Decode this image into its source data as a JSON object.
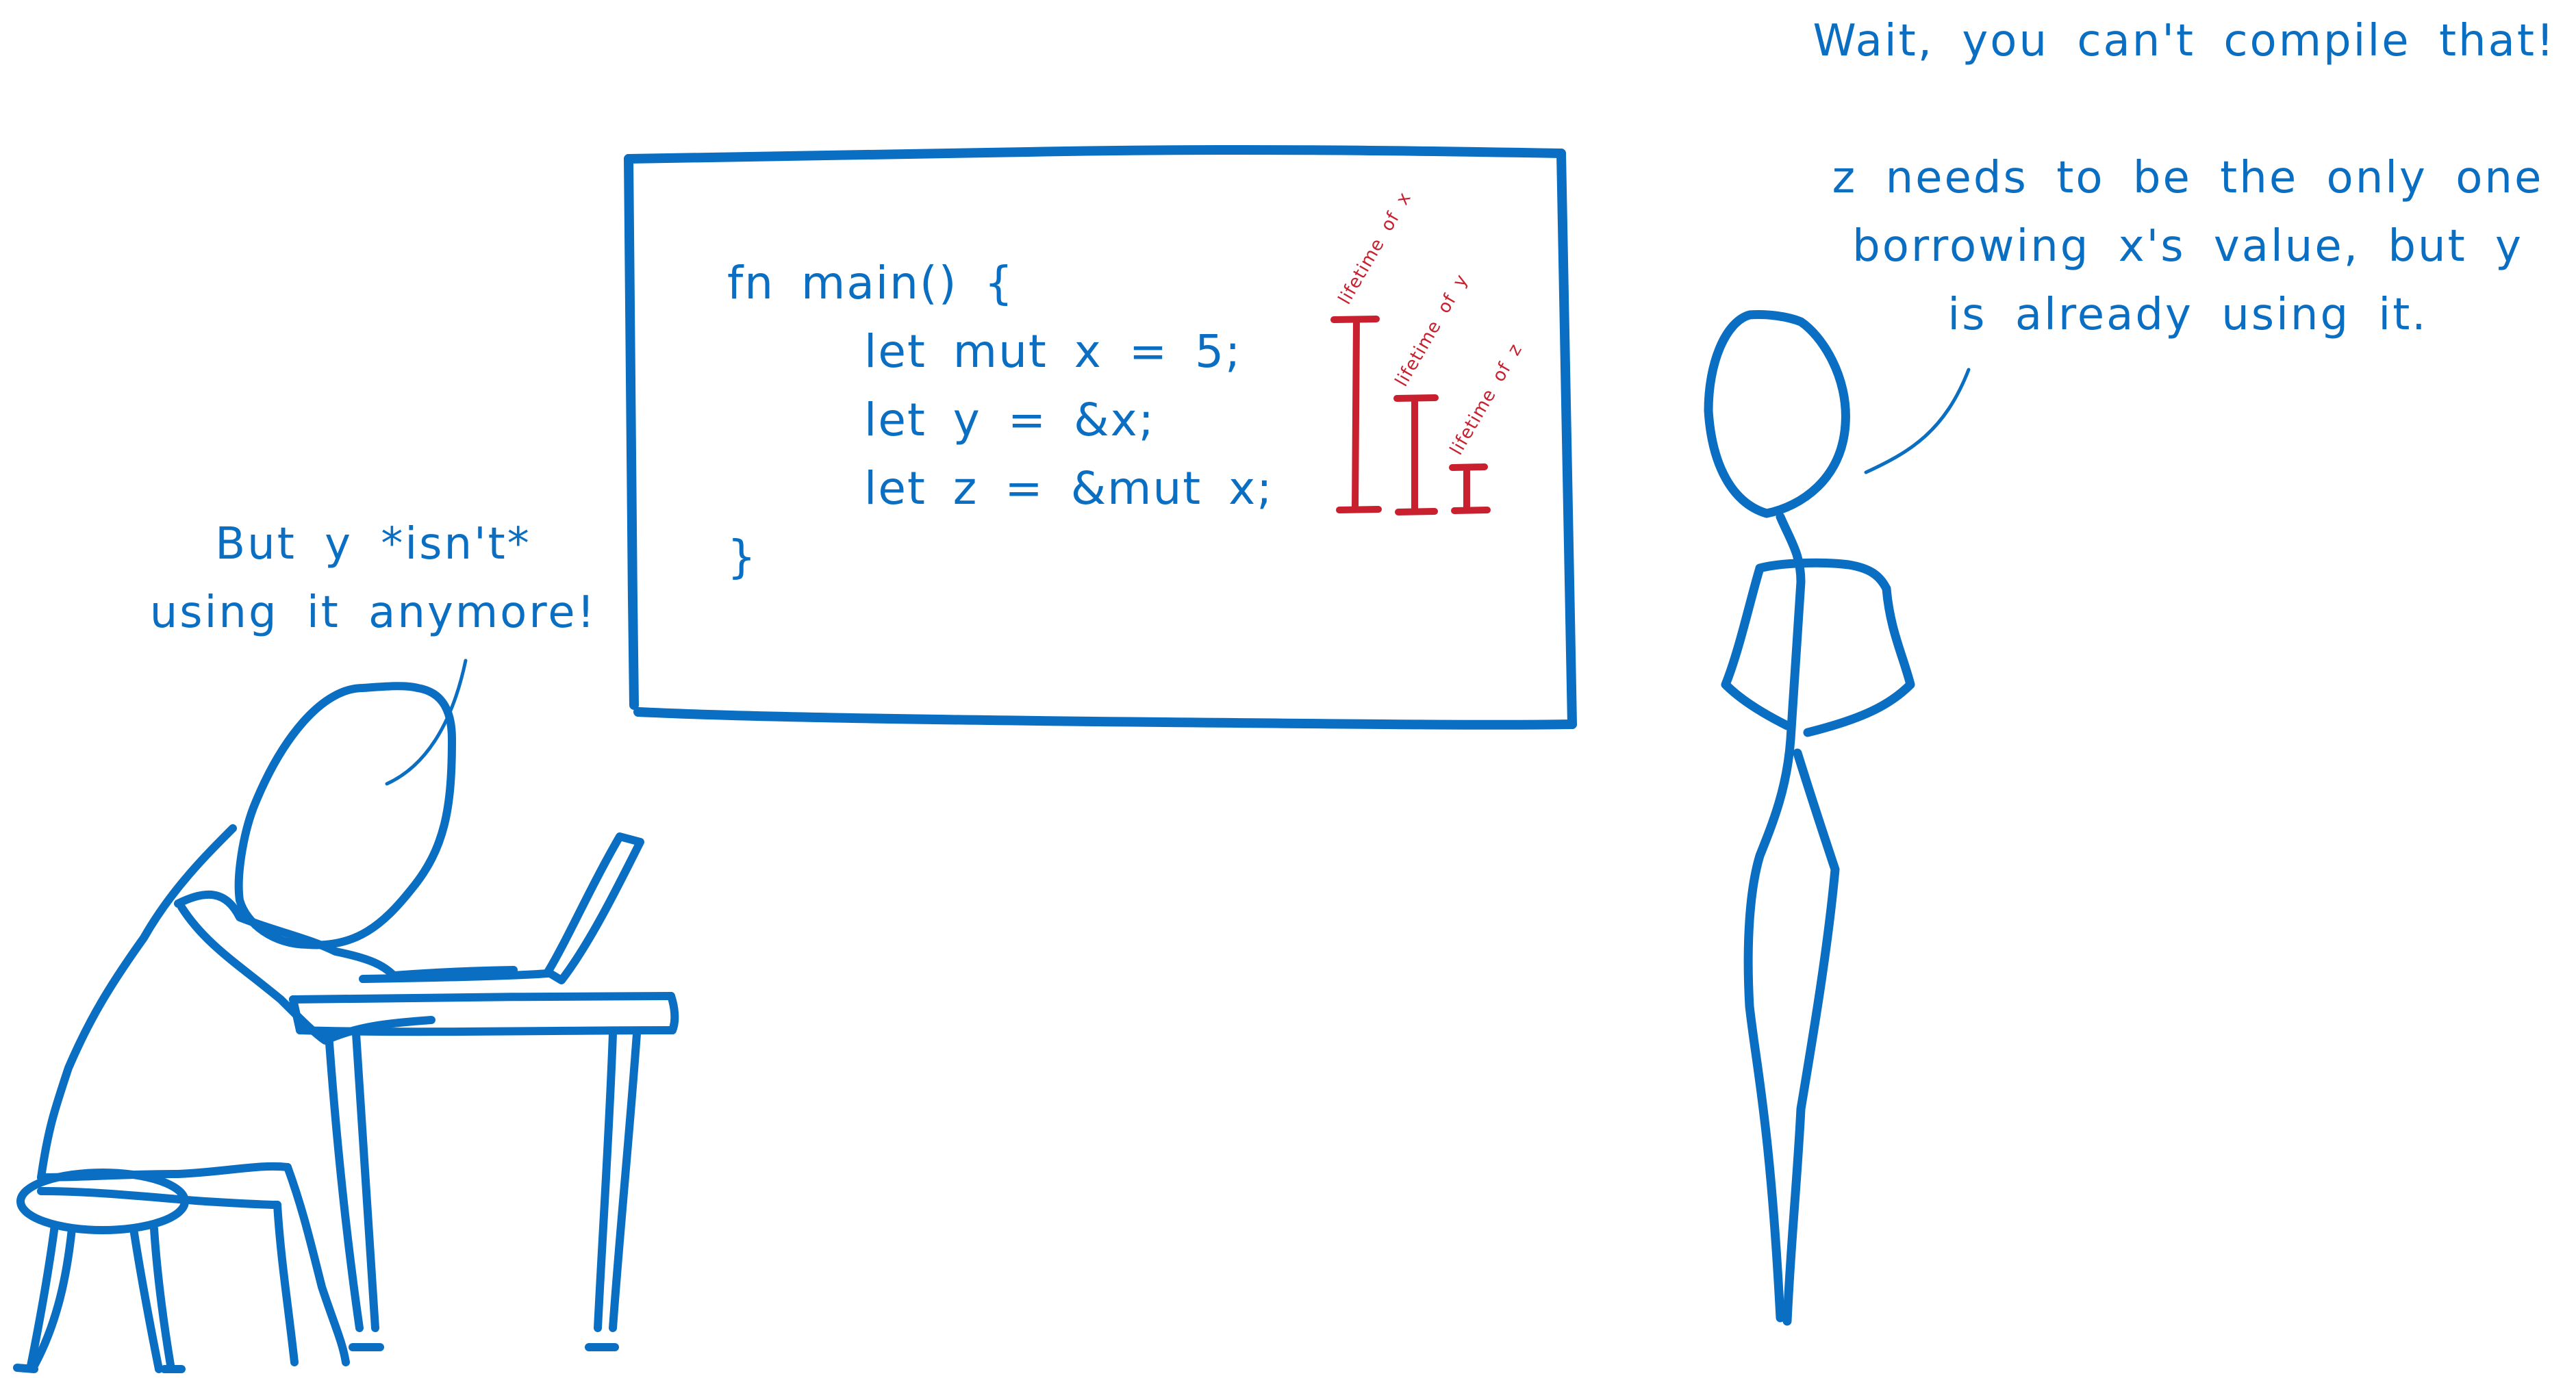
{
  "colors": {
    "ink_blue": "#0a6fc2",
    "ink_red": "#c8202f",
    "background": "#ffffff"
  },
  "whiteboard": {
    "code_lines": [
      "fn main() {",
      "let mut x = 5;",
      "let y = &x;",
      "let z = &mut x;",
      "}"
    ],
    "lifetimes": [
      {
        "label": "lifetime of x",
        "variable": "x"
      },
      {
        "label": "lifetime of y",
        "variable": "y"
      },
      {
        "label": "lifetime of z",
        "variable": "z"
      }
    ]
  },
  "seated_person": {
    "speech_lines": [
      "But y *isn't*",
      "using it anymore!"
    ]
  },
  "standing_person": {
    "exclamation": "Wait, you can't compile that!",
    "explanation_lines": [
      "z needs to be the only one",
      "borrowing x's value, but y",
      "is already using it."
    ]
  }
}
